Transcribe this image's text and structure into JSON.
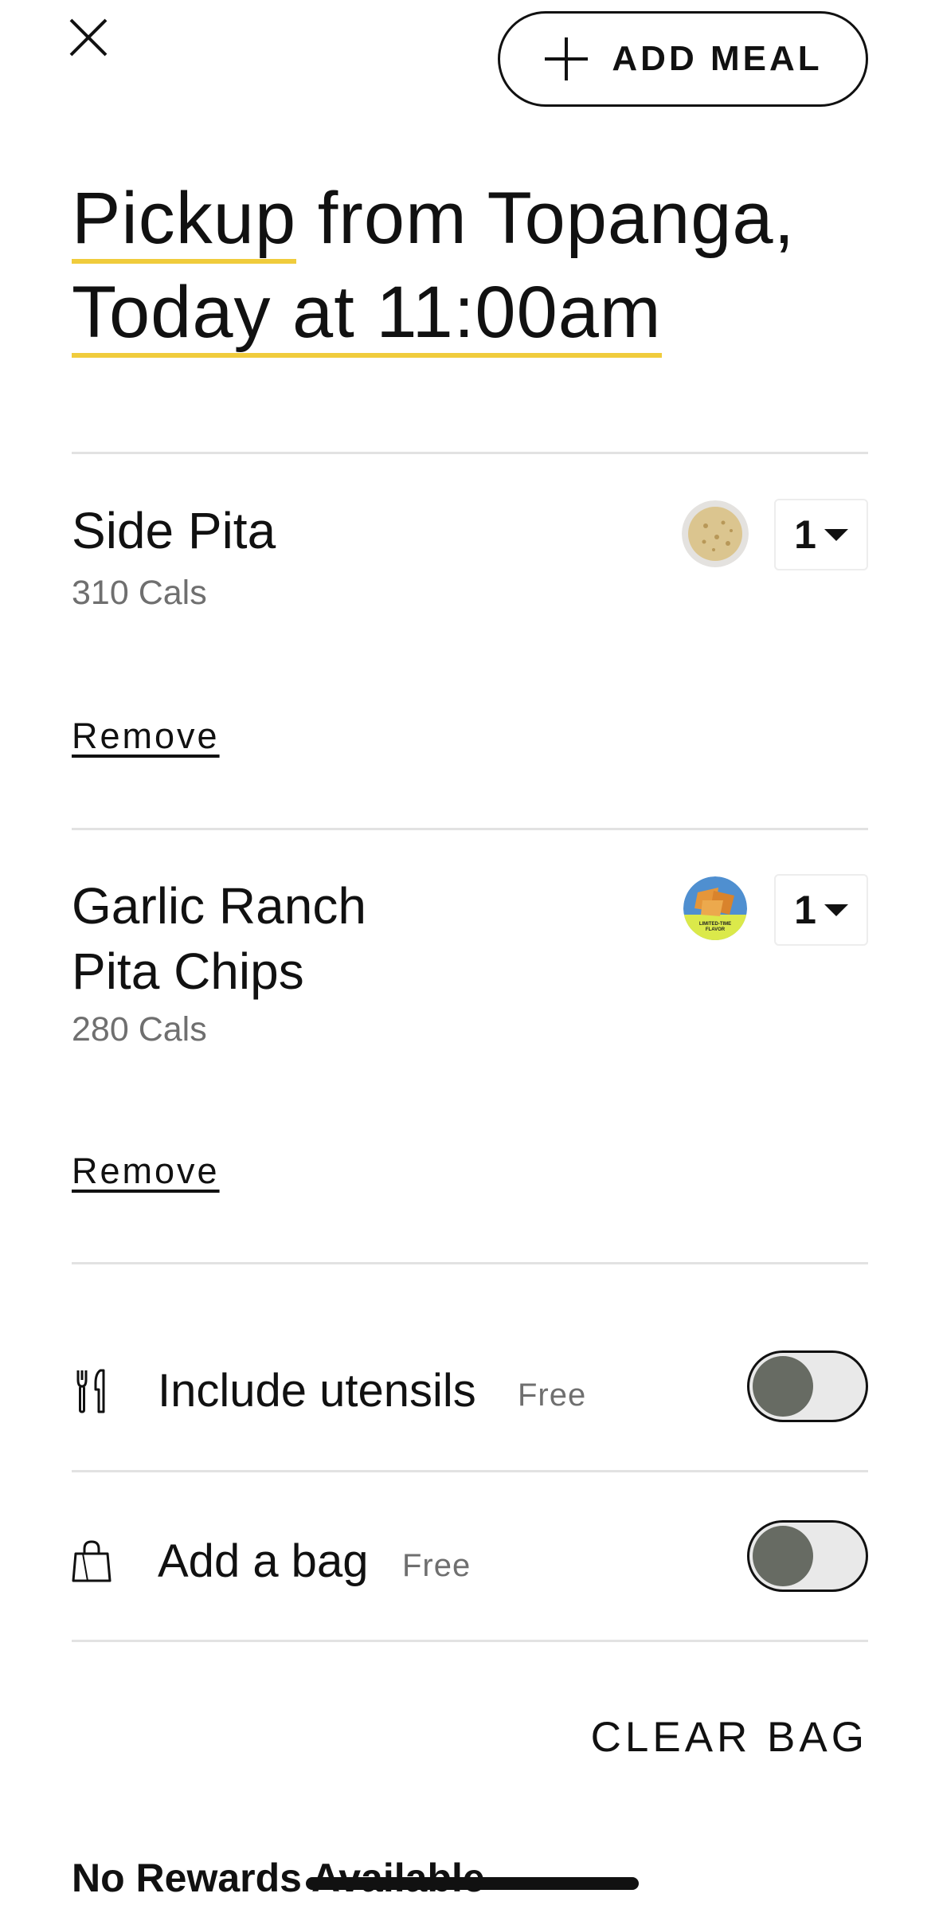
{
  "header": {
    "add_meal_label": "ADD MEAL"
  },
  "title": {
    "pickup": "Pickup",
    "from": " from Topanga,",
    "time": "Today at 11:00am",
    "underline_color": "#f0cc3c"
  },
  "cart": {
    "items": [
      {
        "name": "Side Pita",
        "cals": "310 Cals",
        "quantity": "1",
        "remove_label": "Remove",
        "thumb_icon": "pita-bread-image"
      },
      {
        "name_line1": "Garlic Ranch",
        "name_line2": "Pita Chips",
        "cals": "280 Cals",
        "quantity": "1",
        "remove_label": "Remove",
        "thumb_icon": "pita-chips-image",
        "badge_text": "LIMITED-TIME FLAVOR"
      }
    ]
  },
  "options": [
    {
      "label": "Include utensils",
      "price": "Free",
      "icon": "utensils-icon",
      "enabled": false
    },
    {
      "label": "Add a bag",
      "price": "Free",
      "icon": "bag-icon",
      "enabled": false
    }
  ],
  "actions": {
    "clear_bag": "CLEAR BAG"
  },
  "rewards": {
    "status": "No Rewards Available"
  },
  "colors": {
    "toggle_knob": "#676b63",
    "toggle_track": "#e9e9e9",
    "muted_text": "#6f6f6f"
  }
}
